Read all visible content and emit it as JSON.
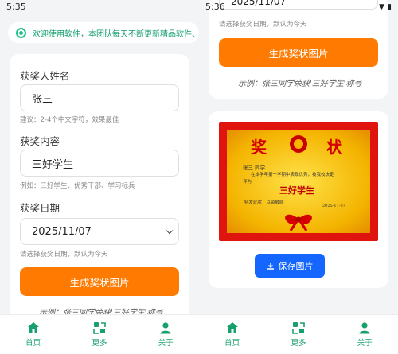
{
  "status_left": {
    "time": "5:35"
  },
  "status_right": {
    "time": "5:36"
  },
  "notice": "欢迎使用软件，本团队每天不断更新精品软件、各类",
  "form": {
    "name_label": "获奖人姓名",
    "name_value": "张三",
    "name_hint": "建议：2-4个中文字符，效果最佳",
    "content_label": "获奖内容",
    "content_value": "三好学生",
    "content_hint": "例如：三好学生、优秀干部、学习标兵",
    "date_label": "获奖日期",
    "date_value": "2025/11/07",
    "date_hint": "请选择获奖日期，默认为今天",
    "generate_button": "生成奖状图片",
    "example": "示例：张三同学荣获'三好学生'称号"
  },
  "certificate": {
    "title_left": "奖",
    "title_right": "状",
    "recipient": "张三",
    "recipient_suffix": "同学",
    "body_line1": "在本学年第一学期中表现优秀，被我校决定",
    "body_line2": "评为",
    "award": "三好学生",
    "closing": "特发此状，以资鼓励",
    "date": "2025-11-07"
  },
  "save_button": "保存图片",
  "tabs": [
    {
      "label": "首页",
      "icon": "home-icon"
    },
    {
      "label": "更多",
      "icon": "more-icon"
    },
    {
      "label": "关于",
      "icon": "user-icon"
    }
  ],
  "colors": {
    "accent": "#ff7a00",
    "brand": "#18a06c",
    "blue": "#1565ff"
  }
}
